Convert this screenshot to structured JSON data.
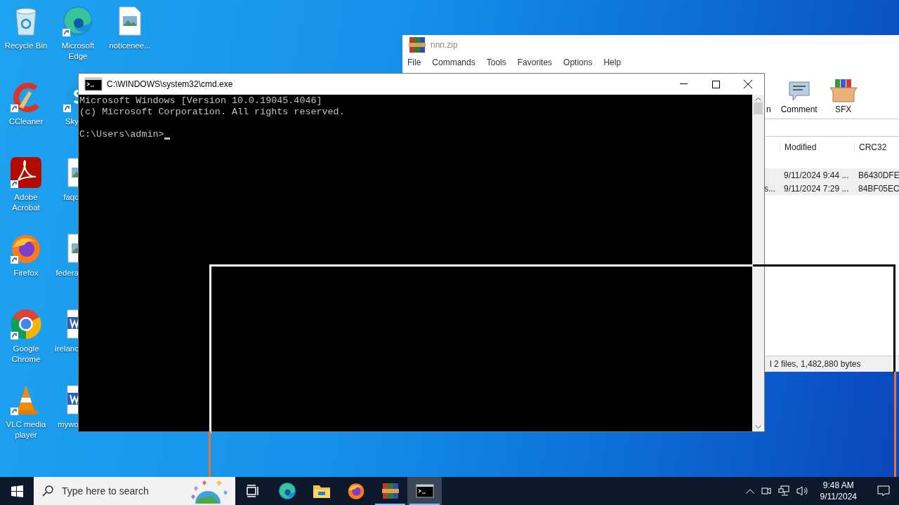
{
  "desktop": {
    "columns": [
      [
        {
          "kind": "recycle",
          "label": "Recycle Bin"
        },
        {
          "kind": "ccleaner",
          "label": "CCleaner",
          "shortcut": true
        },
        {
          "kind": "acrobat",
          "label": "Adobe Acrobat",
          "shortcut": true
        },
        {
          "kind": "firefox",
          "label": "Firefox",
          "shortcut": true
        },
        {
          "kind": "chrome",
          "label": "Google Chrome",
          "shortcut": true
        },
        {
          "kind": "vlc",
          "label": "VLC media player",
          "shortcut": true
        }
      ],
      [
        {
          "kind": "edge",
          "label": "Microsoft Edge",
          "shortcut": true
        },
        {
          "kind": "skype",
          "label": "Sky",
          "shortcut": true
        },
        {
          "kind": "image",
          "label": "faqc"
        },
        {
          "kind": "image",
          "label": "federa"
        },
        {
          "kind": "word",
          "label": "irelanc"
        },
        {
          "kind": "word",
          "label": "mywo"
        }
      ],
      [
        {
          "kind": "image",
          "label": "noticenee..."
        }
      ]
    ]
  },
  "archive_window": {
    "title": "nnn.zip",
    "menu": [
      "File",
      "Commands",
      "Tools",
      "Favorites",
      "Options",
      "Help"
    ],
    "toolbar": [
      {
        "kind": "fragment",
        "label": "n"
      },
      {
        "kind": "comment",
        "label": "Comment"
      },
      {
        "kind": "sfx",
        "label": "SFX"
      }
    ],
    "columns": [
      "Modified",
      "CRC32"
    ],
    "rows": [
      {
        "column_1": "",
        "modified": "9/11/2024 9:44 ...",
        "crc32": "B6430DFE"
      },
      {
        "column_1": "s...",
        "modified": "9/11/2024 7:29 ...",
        "crc32": "84BF05EC"
      }
    ],
    "status": "l 2 files, 1,482,880 bytes"
  },
  "console_window": {
    "title": "C:\\WINDOWS\\system32\\cmd.exe",
    "lines": [
      "Microsoft Windows [Version 10.0.19045.4046]",
      "(c) Microsoft Corporation. All rights reserved."
    ],
    "prompt": "C:\\Users\\admin>"
  },
  "taskbar": {
    "search_placeholder": "Type here to search",
    "apps": [
      {
        "kind": "taskview",
        "selected": false
      },
      {
        "kind": "edge",
        "selected": false
      },
      {
        "kind": "explorer",
        "selected": false
      },
      {
        "kind": "firefox",
        "selected": false
      },
      {
        "kind": "winrar",
        "running": true,
        "selected": false
      },
      {
        "kind": "cmd",
        "running": true,
        "selected": true
      }
    ],
    "time": "9:48 AM",
    "date": "9/11/2024"
  }
}
